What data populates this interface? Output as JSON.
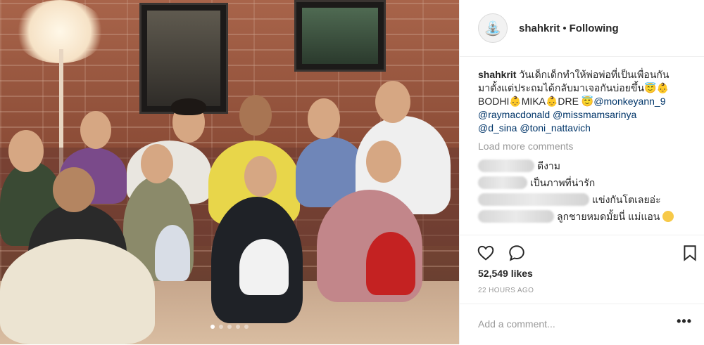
{
  "post": {
    "username": "shahkrit",
    "separator": "•",
    "follow_status": "Following",
    "avatar_icon": "fountain-icon"
  },
  "caption": {
    "username": "shahkrit",
    "line1": "วันเด็กเด็กทำให้พ่อพ่อที่เป็นเพื่อนกัน",
    "line2": "มาตั้งแต่ประถมได้กลับมาเจอกันบ่อยขึ้น😇👶",
    "line3_prefix": "BODHI👶MIKA👶DRE 😇",
    "mention1": "@monkeyann_9",
    "mention2": "@raymacdonald",
    "mention3": "@missmamsarinya",
    "mention4": "@d_sina",
    "mention5": "@toni_nattavich"
  },
  "load_more": "Load more comments",
  "comments": [
    {
      "text": "ดีงาม"
    },
    {
      "text": "เป็นภาพที่น่ารัก"
    },
    {
      "text": "แข่งกันโตเลยอ่ะ"
    },
    {
      "text": "ลูกชายหมดมั้ยนี่ แม่แอน"
    }
  ],
  "likes": "52,549 likes",
  "timestamp": "22 HOURS AGO",
  "add_comment_placeholder": "Add a comment...",
  "more_label": "•••",
  "carousel": {
    "count": 5,
    "active_index": 0
  },
  "colors": {
    "text": "#262626",
    "muted": "#999999",
    "mention": "#003569",
    "border": "#efefef"
  }
}
